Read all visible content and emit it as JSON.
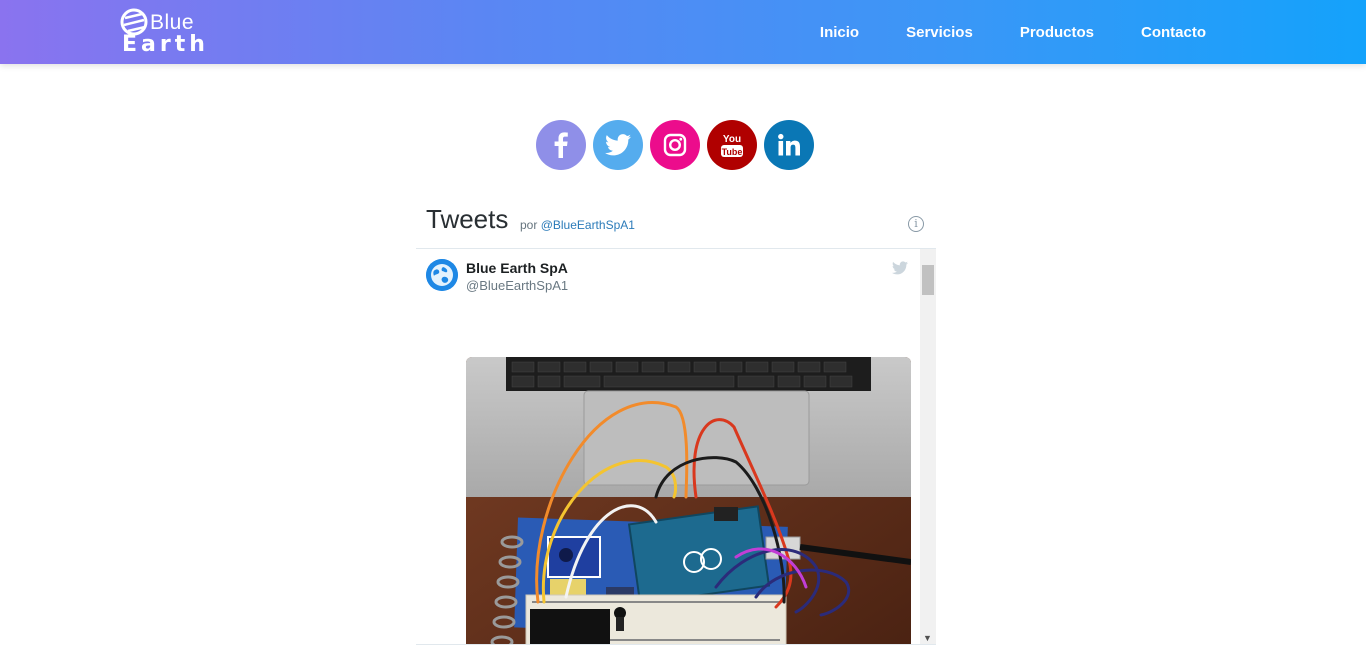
{
  "brand": {
    "line1": "Blue",
    "line2": "Earth"
  },
  "nav": {
    "items": [
      "Inicio",
      "Servicios",
      "Productos",
      "Contacto"
    ]
  },
  "social": {
    "facebook_color": "#8f8fe8",
    "twitter_color": "#55acee",
    "instagram_color": "#ec0c8c",
    "youtube_color": "#b00000",
    "linkedin_color": "#0a77b5",
    "youtube_label_top": "You",
    "youtube_label_bottom": "Tube"
  },
  "timeline": {
    "title": "Tweets",
    "by_prefix": "por",
    "by_handle": "@BlueEarthSpA1",
    "tweet": {
      "author_name": "Blue Earth SpA",
      "author_handle": "@BlueEarthSpA1"
    }
  }
}
